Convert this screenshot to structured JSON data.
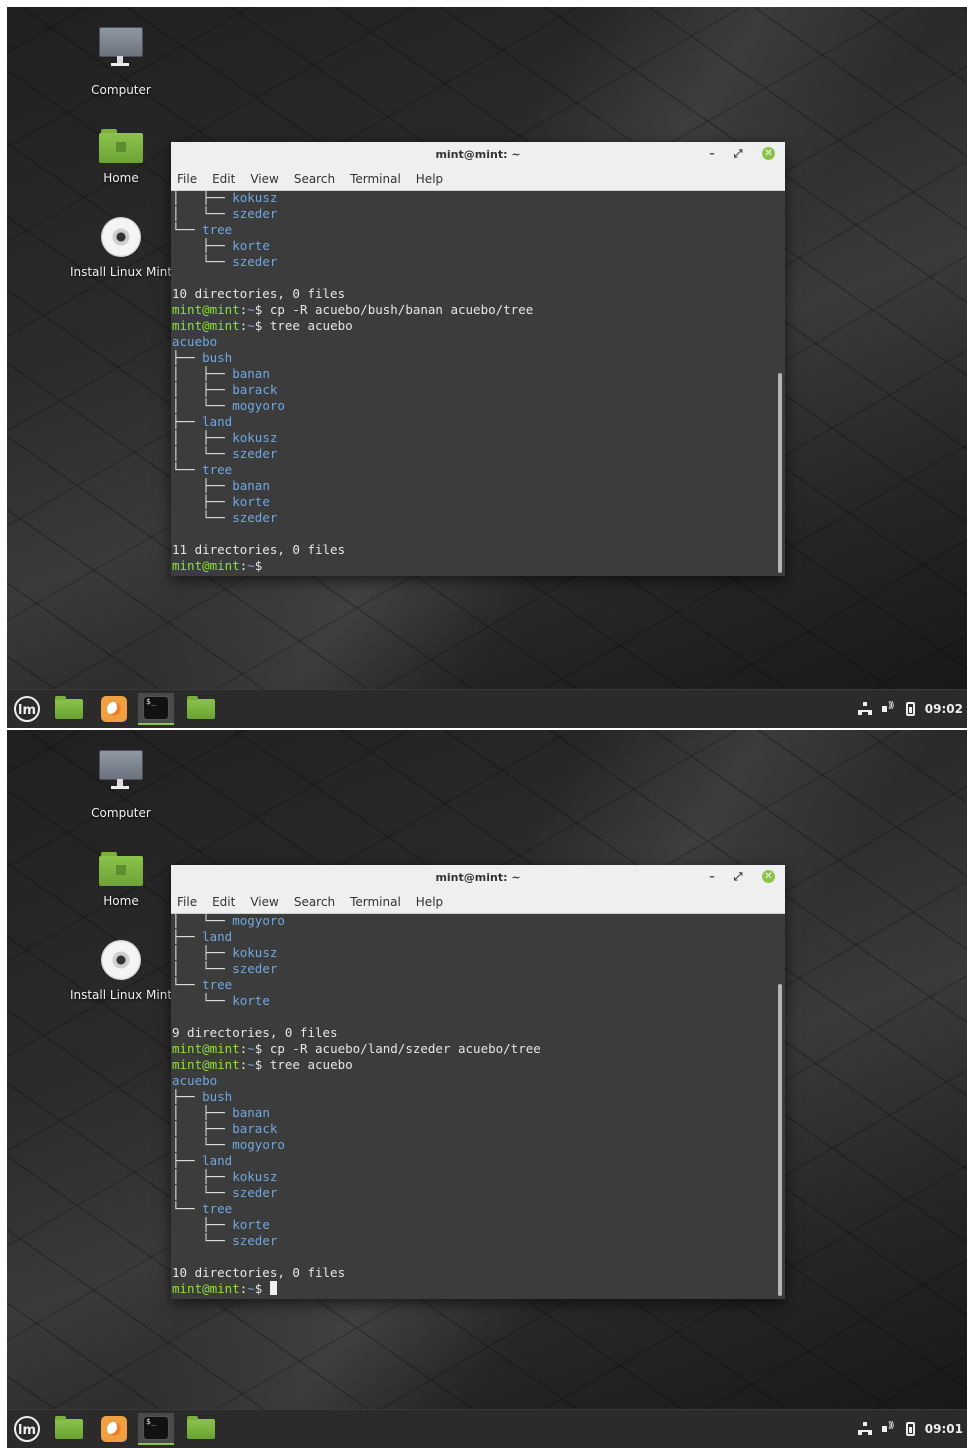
{
  "desktop_icons": {
    "computer": "Computer",
    "home": "Home",
    "install": "Install Linux Mint"
  },
  "colors": {
    "prompt": "#8ae234",
    "directory": "#6fa8e0",
    "accent": "#8cc34a"
  },
  "screens": [
    {
      "window_title": "mint@mint: ~",
      "menu": [
        "File",
        "Edit",
        "View",
        "Search",
        "Terminal",
        "Help"
      ],
      "clock": "09:02",
      "lines": [
        {
          "t": "tree",
          "pre": "│   ├── ",
          "name": "kokusz"
        },
        {
          "t": "tree",
          "pre": "│   └── ",
          "name": "szeder"
        },
        {
          "t": "tree",
          "pre": "└── ",
          "name": "tree"
        },
        {
          "t": "tree",
          "pre": "    ├── ",
          "name": "korte"
        },
        {
          "t": "tree",
          "pre": "    └── ",
          "name": "szeder"
        },
        {
          "t": "text",
          "text": ""
        },
        {
          "t": "text",
          "text": "10 directories, 0 files"
        },
        {
          "t": "cmd",
          "user": "mint@mint",
          "path": "~",
          "cmd": "cp -R acuebo/bush/banan acuebo/tree"
        },
        {
          "t": "cmd",
          "user": "mint@mint",
          "path": "~",
          "cmd": "tree acuebo"
        },
        {
          "t": "tree",
          "pre": "",
          "name": "acuebo"
        },
        {
          "t": "tree",
          "pre": "├── ",
          "name": "bush"
        },
        {
          "t": "tree",
          "pre": "│   ├── ",
          "name": "banan"
        },
        {
          "t": "tree",
          "pre": "│   ├── ",
          "name": "barack"
        },
        {
          "t": "tree",
          "pre": "│   └── ",
          "name": "mogyoro"
        },
        {
          "t": "tree",
          "pre": "├── ",
          "name": "land"
        },
        {
          "t": "tree",
          "pre": "│   ├── ",
          "name": "kokusz"
        },
        {
          "t": "tree",
          "pre": "│   └── ",
          "name": "szeder"
        },
        {
          "t": "tree",
          "pre": "└── ",
          "name": "tree"
        },
        {
          "t": "tree",
          "pre": "    ├── ",
          "name": "banan"
        },
        {
          "t": "tree",
          "pre": "    ├── ",
          "name": "korte"
        },
        {
          "t": "tree",
          "pre": "    └── ",
          "name": "szeder"
        },
        {
          "t": "text",
          "text": ""
        },
        {
          "t": "text",
          "text": "11 directories, 0 files"
        },
        {
          "t": "cmd",
          "user": "mint@mint",
          "path": "~",
          "cmd": "",
          "cursor": false
        }
      ]
    },
    {
      "window_title": "mint@mint: ~",
      "menu": [
        "File",
        "Edit",
        "View",
        "Search",
        "Terminal",
        "Help"
      ],
      "clock": "09:01",
      "lines": [
        {
          "t": "tree",
          "pre": "│   └── ",
          "name": "mogyoro"
        },
        {
          "t": "tree",
          "pre": "├── ",
          "name": "land"
        },
        {
          "t": "tree",
          "pre": "│   ├── ",
          "name": "kokusz"
        },
        {
          "t": "tree",
          "pre": "│   └── ",
          "name": "szeder"
        },
        {
          "t": "tree",
          "pre": "└── ",
          "name": "tree"
        },
        {
          "t": "tree",
          "pre": "    └── ",
          "name": "korte"
        },
        {
          "t": "text",
          "text": ""
        },
        {
          "t": "text",
          "text": "9 directories, 0 files"
        },
        {
          "t": "cmd",
          "user": "mint@mint",
          "path": "~",
          "cmd": "cp -R acuebo/land/szeder acuebo/tree"
        },
        {
          "t": "cmd",
          "user": "mint@mint",
          "path": "~",
          "cmd": "tree acuebo"
        },
        {
          "t": "tree",
          "pre": "",
          "name": "acuebo"
        },
        {
          "t": "tree",
          "pre": "├── ",
          "name": "bush"
        },
        {
          "t": "tree",
          "pre": "│   ├── ",
          "name": "banan"
        },
        {
          "t": "tree",
          "pre": "│   ├── ",
          "name": "barack"
        },
        {
          "t": "tree",
          "pre": "│   └── ",
          "name": "mogyoro"
        },
        {
          "t": "tree",
          "pre": "├── ",
          "name": "land"
        },
        {
          "t": "tree",
          "pre": "│   ├── ",
          "name": "kokusz"
        },
        {
          "t": "tree",
          "pre": "│   └── ",
          "name": "szeder"
        },
        {
          "t": "tree",
          "pre": "└── ",
          "name": "tree"
        },
        {
          "t": "tree",
          "pre": "    ├── ",
          "name": "korte"
        },
        {
          "t": "tree",
          "pre": "    └── ",
          "name": "szeder"
        },
        {
          "t": "text",
          "text": ""
        },
        {
          "t": "text",
          "text": "10 directories, 0 files"
        },
        {
          "t": "cmd",
          "user": "mint@mint",
          "path": "~",
          "cmd": "",
          "cursor": true
        }
      ]
    }
  ],
  "panel": {
    "menu_icon": "linux-mint-menu-icon",
    "launchers": [
      "show-desktop-icon",
      "firefox-icon",
      "terminal-icon",
      "files-icon"
    ],
    "tray_icons": [
      "network-icon",
      "volume-icon",
      "battery-icon"
    ]
  }
}
